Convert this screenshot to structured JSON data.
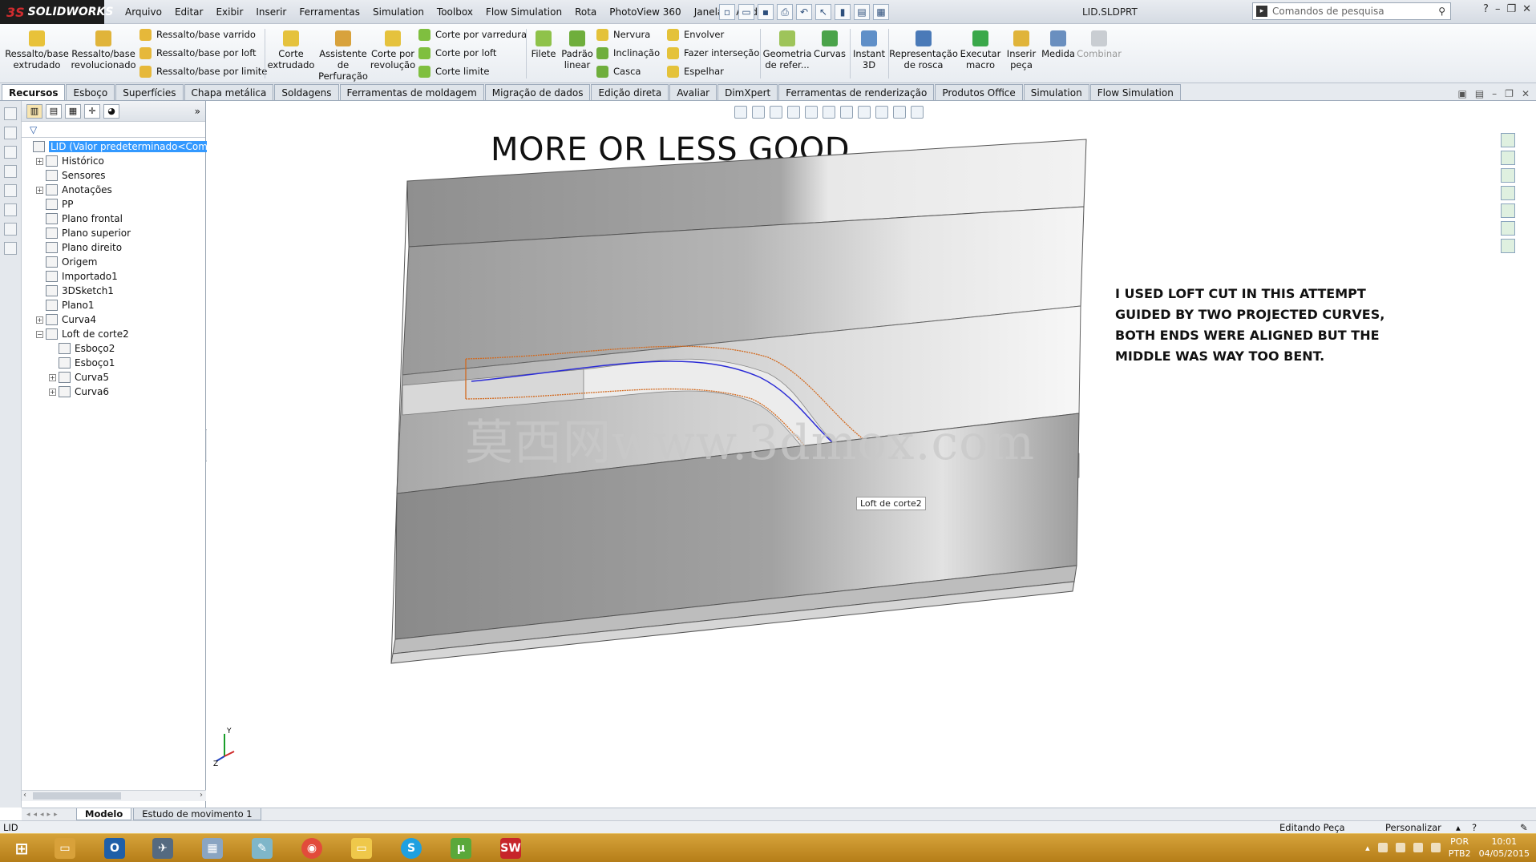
{
  "app": {
    "brand": "SOLIDWORKS",
    "document_title": "LID.SLDPRT",
    "menu": [
      "Arquivo",
      "Editar",
      "Exibir",
      "Inserir",
      "Ferramentas",
      "Simulation",
      "Toolbox",
      "Flow Simulation",
      "Rota",
      "PhotoView 360",
      "Janela",
      "Ajuda"
    ],
    "search_placeholder": "Comandos de pesquisa"
  },
  "ribbon": {
    "extruded_boss": "Ressalto/base extrudado",
    "revolved_boss": "Ressalto/base revolucionado",
    "swept_boss": "Ressalto/base varrido",
    "lofted_boss": "Ressalto/base por loft",
    "boundary_boss": "Ressalto/base por limite",
    "extruded_cut": "Corte extrudado",
    "hole_wizard": "Assistente de Perfuração",
    "revolved_cut": "Corte por revolução",
    "swept_cut": "Corte por varredura",
    "lofted_cut": "Corte por loft",
    "boundary_cut": "Corte limite",
    "fillet": "Filete",
    "linear_pattern": "Padrão linear",
    "rib": "Nervura",
    "draft": "Inclinação",
    "shell": "Casca",
    "wrap": "Envolver",
    "intersect": "Fazer interseção",
    "mirror": "Espelhar",
    "ref_geometry": "Geometria de refer...",
    "curves": "Curvas",
    "instant3d": "Instant 3D",
    "thread": "Representação de rosca",
    "run_macro": "Executar macro",
    "insert_part": "Inserir peça",
    "measure": "Medida",
    "combine": "Combinar"
  },
  "command_tabs": [
    "Recursos",
    "Esboço",
    "Superfícies",
    "Chapa metálica",
    "Soldagens",
    "Ferramentas de moldagem",
    "Migração de dados",
    "Edição direta",
    "Avaliar",
    "DimXpert",
    "Ferramentas de renderização",
    "Produtos Office",
    "Simulation",
    "Flow Simulation"
  ],
  "active_tab": "Recursos",
  "tree": [
    {
      "label": "LID  (Valor predeterminado<Como usi",
      "level": 0,
      "expander": "",
      "icon": "part-icon",
      "selected": true
    },
    {
      "label": "Histórico",
      "level": 1,
      "expander": "+",
      "icon": "history-icon"
    },
    {
      "label": "Sensores",
      "level": 1,
      "expander": "",
      "icon": "sensor-icon"
    },
    {
      "label": "Anotações",
      "level": 1,
      "expander": "+",
      "icon": "annotation-icon"
    },
    {
      "label": "PP",
      "level": 1,
      "expander": "",
      "icon": "material-icon"
    },
    {
      "label": "Plano frontal",
      "level": 1,
      "expander": "",
      "icon": "plane-icon"
    },
    {
      "label": "Plano superior",
      "level": 1,
      "expander": "",
      "icon": "plane-icon"
    },
    {
      "label": "Plano direito",
      "level": 1,
      "expander": "",
      "icon": "plane-icon"
    },
    {
      "label": "Origem",
      "level": 1,
      "expander": "",
      "icon": "origin-icon"
    },
    {
      "label": "Importado1",
      "level": 1,
      "expander": "",
      "icon": "imported-icon"
    },
    {
      "label": "3DSketch1",
      "level": 1,
      "expander": "",
      "icon": "sketch3d-icon"
    },
    {
      "label": "Plano1",
      "level": 1,
      "expander": "",
      "icon": "plane-icon"
    },
    {
      "label": "Curva4",
      "level": 1,
      "expander": "+",
      "icon": "curve-icon"
    },
    {
      "label": "Loft de corte2",
      "level": 1,
      "expander": "-",
      "icon": "loft-cut-icon"
    },
    {
      "label": "Esboço2",
      "level": 2,
      "expander": "",
      "icon": "sketch-icon"
    },
    {
      "label": "Esboço1",
      "level": 2,
      "expander": "",
      "icon": "sketch-icon"
    },
    {
      "label": "Curva5",
      "level": 2,
      "expander": "+",
      "icon": "curve-icon"
    },
    {
      "label": "Curva6",
      "level": 2,
      "expander": "+",
      "icon": "curve-icon"
    }
  ],
  "viewport": {
    "heading": "MORE OR LESS GOOD",
    "note": "I USED LOFT CUT IN THIS ATTEMPT GUIDED BY TWO PROJECTED CURVES, BOTH ENDS WERE ALIGNED BUT THE MIDDLE WAS WAY TOO BENT.",
    "watermark": "莫西网www.3dmox.com",
    "tooltip": "Loft de corte2",
    "triad_y": "Y",
    "triad_z": "Z"
  },
  "bottom_tabs": [
    "Modelo",
    "Estudo de movimento 1"
  ],
  "status": {
    "left": "LID",
    "mode": "Editando Peça",
    "customize": "Personalizar"
  },
  "taskbar": {
    "lang_top": "POR",
    "lang_bottom": "PTB2",
    "time": "10:01",
    "date": "04/05/2015"
  },
  "colors": {
    "selection": "#3399ff",
    "taskbar": "#c9922b",
    "curve_blue": "#2b2bd6",
    "curve_orange": "#d2691e"
  }
}
